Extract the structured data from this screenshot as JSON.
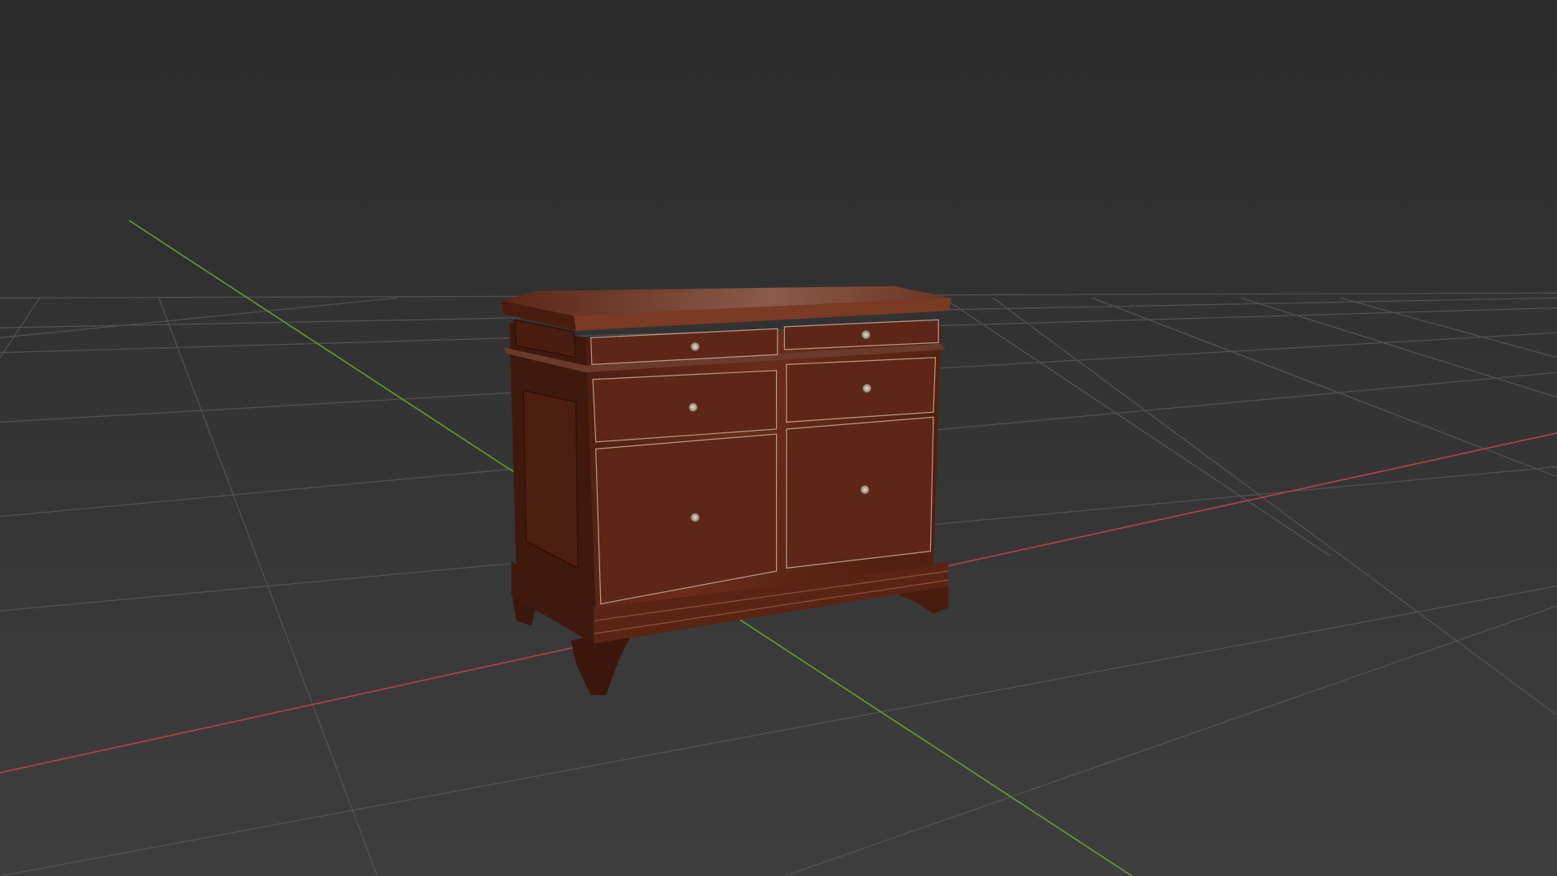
{
  "viewport": {
    "type": "3d-viewport",
    "object": "wooden-cabinet",
    "colors": {
      "background_top": "#2c2c2c",
      "background_bottom": "#3d3d3d",
      "grid": "#555555",
      "x_axis": "#b8404f",
      "y_axis": "#6a9a2c",
      "wood_light": "#6e2f1c",
      "wood_dark": "#3a160d",
      "knob": "#c9bca8"
    }
  }
}
